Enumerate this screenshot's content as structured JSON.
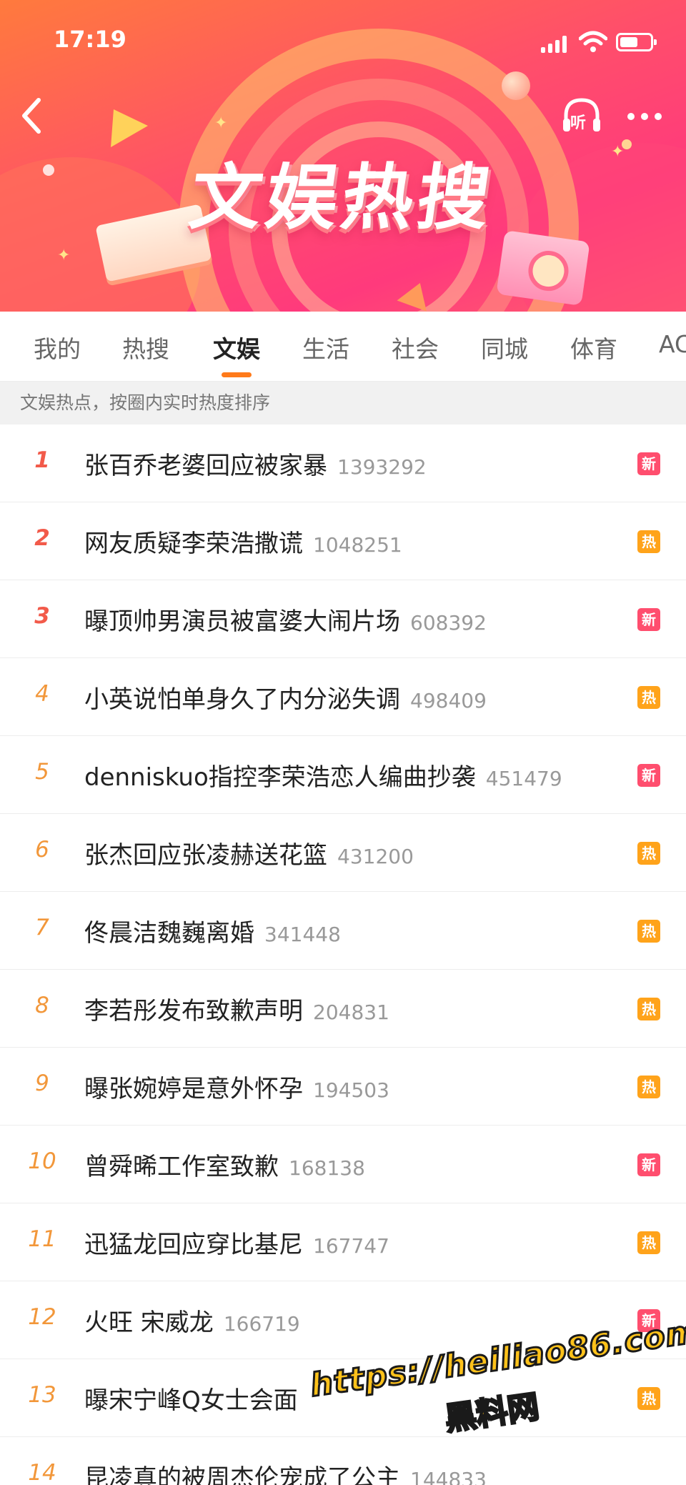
{
  "status_bar": {
    "time": "17:19"
  },
  "banner": {
    "title": "文娱热搜",
    "listen_label": "听"
  },
  "tabs": [
    {
      "label": "我的"
    },
    {
      "label": "热搜"
    },
    {
      "label": "文娱",
      "active": true
    },
    {
      "label": "生活"
    },
    {
      "label": "社会"
    },
    {
      "label": "同城"
    },
    {
      "label": "体育"
    },
    {
      "label": "AC"
    }
  ],
  "subheader": "文娱热点，按圈内实时热度排序",
  "list": [
    {
      "rank": "1",
      "title": "张百乔老婆回应被家暴",
      "count": "1393292",
      "badge": "新",
      "badge_type": "new"
    },
    {
      "rank": "2",
      "title": "网友质疑李荣浩撒谎",
      "count": "1048251",
      "badge": "热",
      "badge_type": "hot"
    },
    {
      "rank": "3",
      "title": "曝顶帅男演员被富婆大闹片场",
      "count": "608392",
      "badge": "新",
      "badge_type": "new"
    },
    {
      "rank": "4",
      "title": "小英说怕单身久了内分泌失调",
      "count": "498409",
      "badge": "热",
      "badge_type": "hot"
    },
    {
      "rank": "5",
      "title": "denniskuo指控李荣浩恋人编曲抄袭",
      "count": "451479",
      "badge": "新",
      "badge_type": "new"
    },
    {
      "rank": "6",
      "title": "张杰回应张凌赫送花篮",
      "count": "431200",
      "badge": "热",
      "badge_type": "hot"
    },
    {
      "rank": "7",
      "title": "佟晨洁魏巍离婚",
      "count": "341448",
      "badge": "热",
      "badge_type": "hot"
    },
    {
      "rank": "8",
      "title": "李若彤发布致歉声明",
      "count": "204831",
      "badge": "热",
      "badge_type": "hot"
    },
    {
      "rank": "9",
      "title": "曝张婉婷是意外怀孕",
      "count": "194503",
      "badge": "热",
      "badge_type": "hot"
    },
    {
      "rank": "10",
      "title": "曾舜晞工作室致歉",
      "count": "168138",
      "badge": "新",
      "badge_type": "new"
    },
    {
      "rank": "11",
      "title": "迅猛龙回应穿比基尼",
      "count": "167747",
      "badge": "热",
      "badge_type": "hot"
    },
    {
      "rank": "12",
      "title": "火旺 宋威龙",
      "count": "166719",
      "badge": "新",
      "badge_type": "new"
    },
    {
      "rank": "13",
      "title": "曝宋宁峰Q女士会面",
      "count": "",
      "badge": "热",
      "badge_type": "hot"
    },
    {
      "rank": "14",
      "title": "昆凌真的被周杰伦宠成了公主",
      "count": "144833",
      "badge": "",
      "badge_type": ""
    }
  ],
  "watermark": {
    "url": "https://heiliao86.com",
    "name": "黑料网"
  },
  "colors": {
    "accent": "#ff7a1a",
    "rank_top": "#f25a4a",
    "rank_other": "#f2973a",
    "badge_new": "#ff4e6e",
    "badge_hot": "#ffa31a"
  }
}
